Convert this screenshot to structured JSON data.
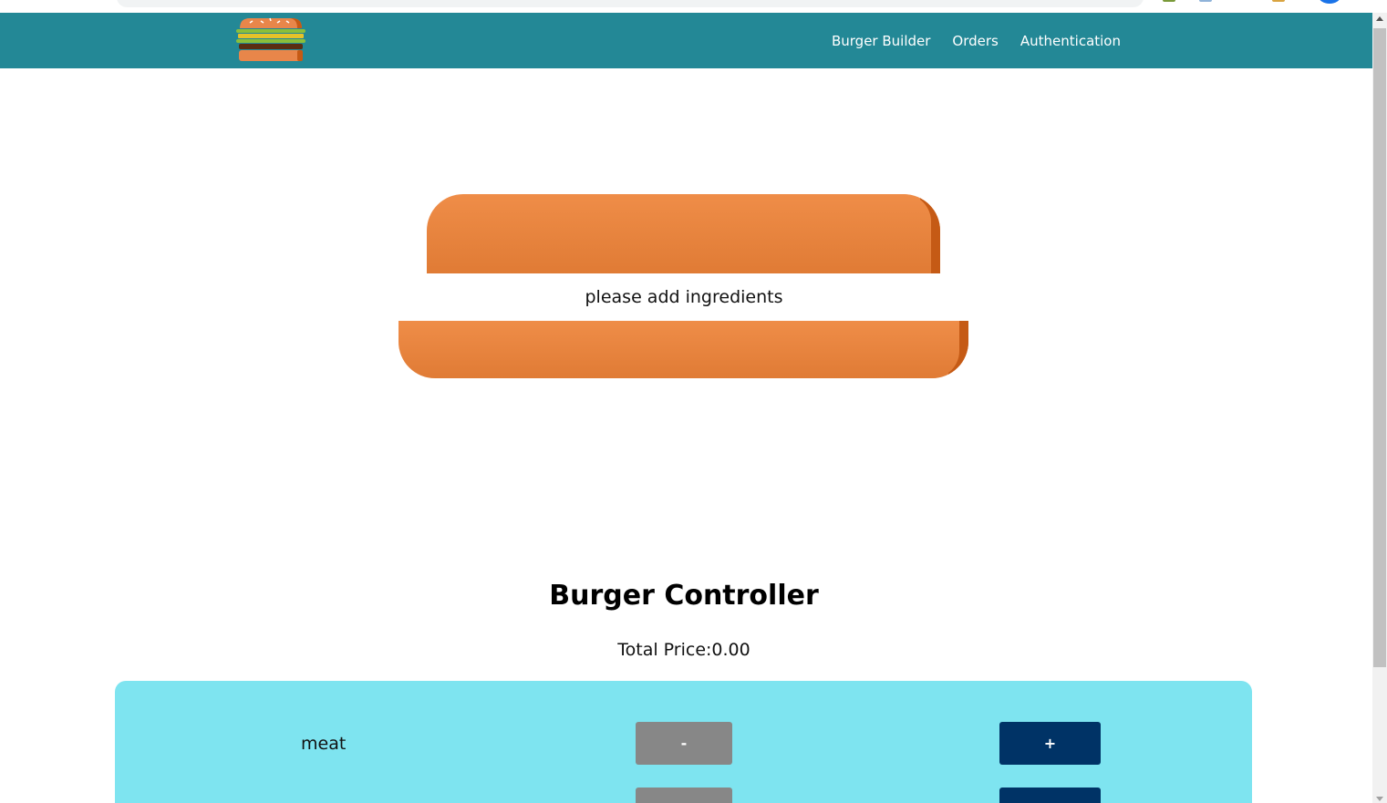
{
  "toolbar": {
    "logo_icon": "burger-logo-icon",
    "background": "#238896",
    "nav_items": [
      {
        "label": "Burger Builder"
      },
      {
        "label": "Orders"
      },
      {
        "label": "Authentication"
      }
    ]
  },
  "burger": {
    "empty_message": "please add ingredients",
    "bread_color": "#e07b35"
  },
  "controller": {
    "title": "Burger Controller",
    "total_price": "Total Price:0.00",
    "panel_color": "#7ee4f0",
    "rows": [
      {
        "label": "meat",
        "less_label": "-",
        "more_label": "+"
      },
      {
        "label": "",
        "less_label": "",
        "more_label": ""
      }
    ]
  },
  "colors": {
    "less_button": "#878787",
    "more_button": "#003366"
  }
}
